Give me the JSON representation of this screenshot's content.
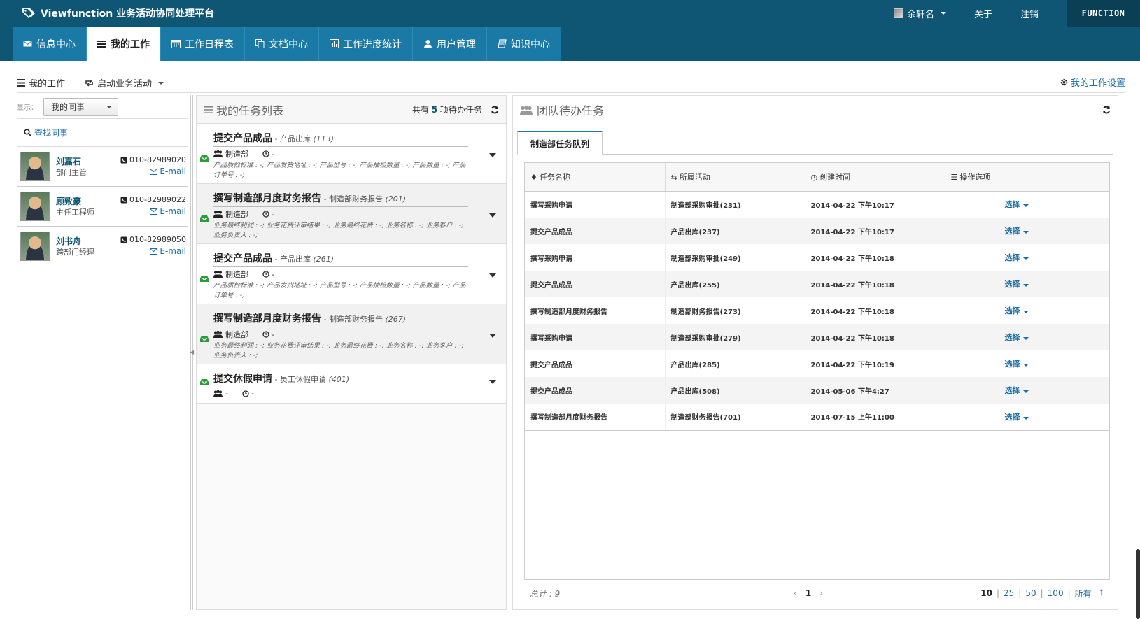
{
  "header": {
    "app_title": "Viewfunction 业务活动协同处理平台",
    "user_name": "余轩名",
    "about": "关于",
    "logout": "注销",
    "logo_text": "FUNCTION"
  },
  "nav": {
    "tabs": [
      {
        "label": "信息中心",
        "icon": "envelope-icon"
      },
      {
        "label": "我的工作",
        "icon": "list-icon",
        "active": true
      },
      {
        "label": "工作日程表",
        "icon": "calendar-icon"
      },
      {
        "label": "文档中心",
        "icon": "copy-icon"
      },
      {
        "label": "工作进度统计",
        "icon": "chart-icon"
      },
      {
        "label": "用户管理",
        "icon": "user-icon"
      },
      {
        "label": "知识中心",
        "icon": "book-icon"
      }
    ]
  },
  "toolbar": {
    "my_work": "我的工作",
    "start_activity": "启动业务活动",
    "settings": "我的工作设置"
  },
  "colleagues": {
    "show_label": "显示：",
    "show_value": "我的同事",
    "find": "查找同事",
    "people": [
      {
        "name": "刘嘉石",
        "role": "部门主管",
        "phone": "010-82989020",
        "email": "E-mail"
      },
      {
        "name": "顾致豪",
        "role": "主任工程师",
        "phone": "010-82989022",
        "email": "E-mail"
      },
      {
        "name": "刘书舟",
        "role": "跨部门经理",
        "phone": "010-82989050",
        "email": "E-mail"
      }
    ]
  },
  "tasks": {
    "title": "我的任务列表",
    "count_prefix": "共有",
    "count": "5",
    "count_suffix": "项待办任务",
    "items": [
      {
        "name": "提交产品成品",
        "activity": " - 产品出库",
        "id": "(113)",
        "dept": "制造部",
        "due": "-",
        "fields": "产品质检标准 : -;  产品发货地址 : -;  产品型号 : -;  产品抽检数量 : -;  产品数量 : -;  产品订单号 : -;"
      },
      {
        "name": "撰写制造部月度财务报告",
        "activity": " - 制造部财务报告",
        "id": "(201)",
        "dept": "制造部",
        "due": "-",
        "fields": "业务最终利润 : -;  业务花费评审结果 : -;  业务最终花费 : -;  业务名称 : -;  业务客户 : -;  业务负责人 : -;"
      },
      {
        "name": "提交产品成品",
        "activity": " - 产品出库",
        "id": "(261)",
        "dept": "制造部",
        "due": "-",
        "fields": "产品质检标准 : -;  产品发货地址 : -;  产品型号 : -;  产品抽检数量 : -;  产品数量 : -;  产品订单号 : -;"
      },
      {
        "name": "撰写制造部月度财务报告",
        "activity": " - 制造部财务报告",
        "id": "(267)",
        "dept": "制造部",
        "due": "-",
        "fields": "业务最终利润 : -;  业务花费评审结果 : -;  业务最终花费 : -;  业务名称 : -;  业务客户 : -;  业务负责人 : -;"
      },
      {
        "name": "提交休假申请",
        "activity": " - 员工休假申请",
        "id": "(401)",
        "dept": "-",
        "due": "-",
        "fields": ""
      }
    ]
  },
  "team": {
    "title": "团队待办任务",
    "queue_tab": "制造部任务队列",
    "columns": [
      "任务名称",
      "所属活动",
      "创建时间",
      "操作选项"
    ],
    "rows": [
      {
        "task": "撰写采购申请",
        "activity": "制造部采购审批(231)",
        "time": "2014-04-22 下午10:17",
        "op": "选择"
      },
      {
        "task": "提交产品成品",
        "activity": "产品出库(237)",
        "time": "2014-04-22 下午10:17",
        "op": "选择"
      },
      {
        "task": "撰写采购申请",
        "activity": "制造部采购审批(249)",
        "time": "2014-04-22 下午10:18",
        "op": "选择"
      },
      {
        "task": "提交产品成品",
        "activity": "产品出库(255)",
        "time": "2014-04-22 下午10:18",
        "op": "选择"
      },
      {
        "task": "撰写制造部月度财务报告",
        "activity": "制造部财务报告(273)",
        "time": "2014-04-22 下午10:18",
        "op": "选择"
      },
      {
        "task": "撰写采购申请",
        "activity": "制造部采购审批(279)",
        "time": "2014-04-22 下午10:18",
        "op": "选择"
      },
      {
        "task": "提交产品成品",
        "activity": "产品出库(285)",
        "time": "2014-04-22 下午10:19",
        "op": "选择"
      },
      {
        "task": "提交产品成品",
        "activity": "产品出库(508)",
        "time": "2014-05-06 下午4:27",
        "op": "选择"
      },
      {
        "task": "撰写制造部月度财务报告",
        "activity": "制造部财务报告(701)",
        "time": "2014-07-15 上午11:00",
        "op": "选择"
      }
    ],
    "pager": {
      "total": "总计 : 9",
      "current_page": "1",
      "sizes": [
        "10",
        "25",
        "50",
        "100",
        "所有"
      ]
    }
  }
}
